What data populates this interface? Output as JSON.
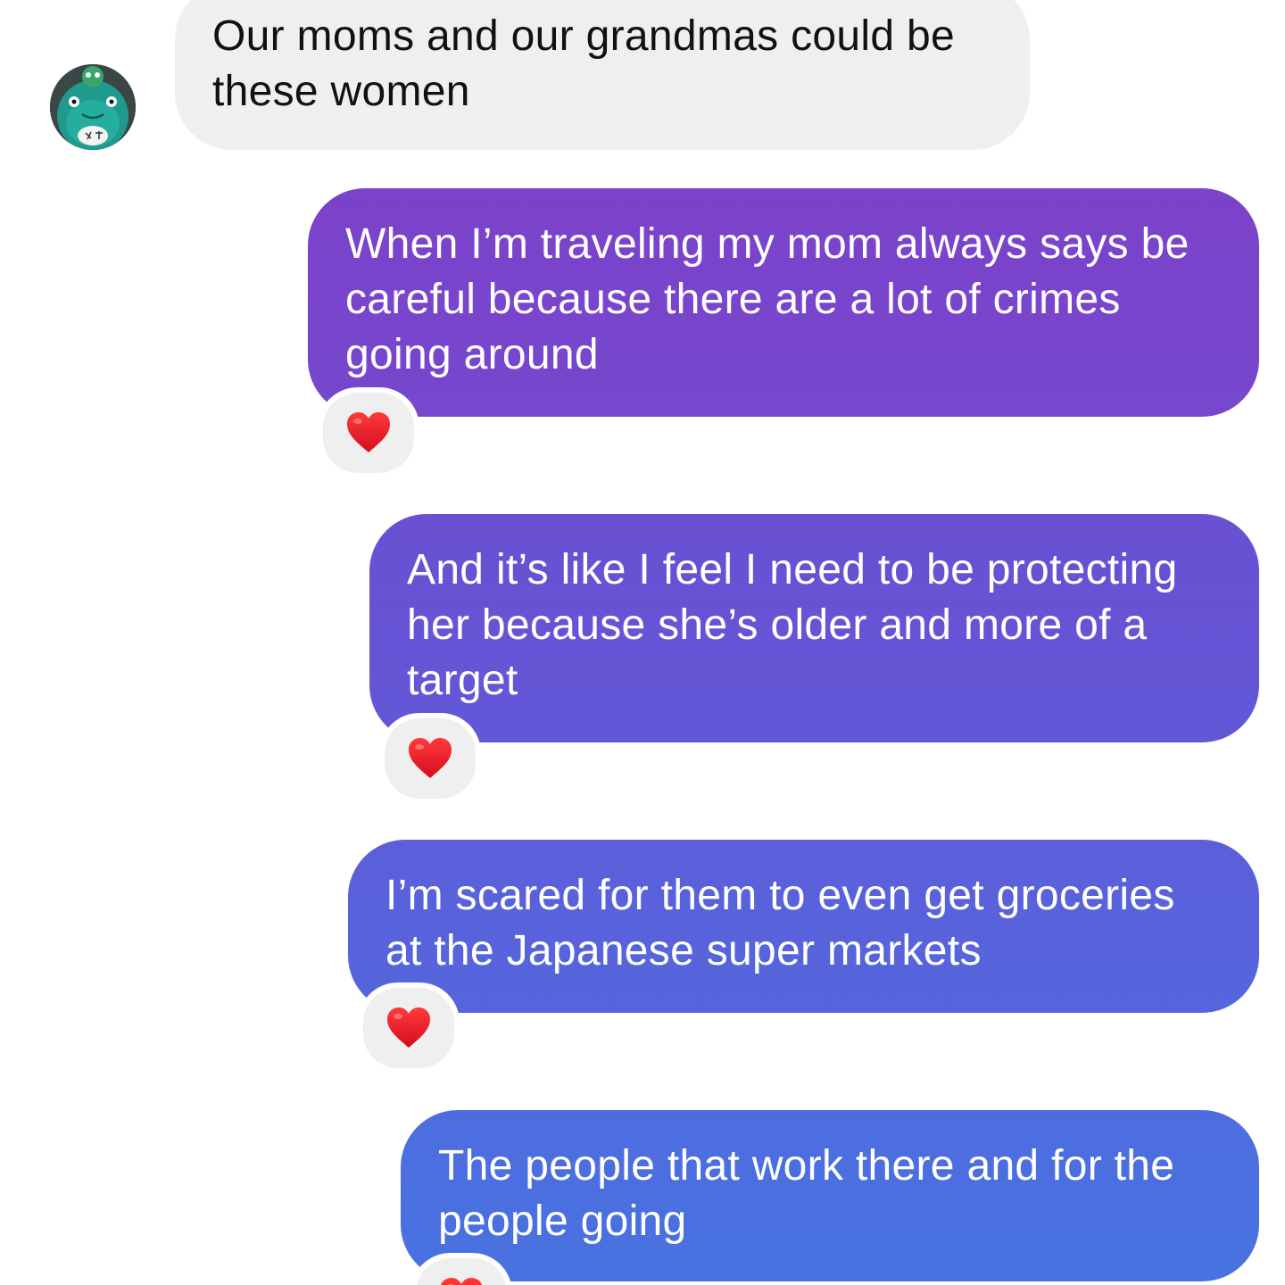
{
  "messages": [
    {
      "direction": "incoming",
      "text": "Our moms and our grandmas could be these women"
    },
    {
      "direction": "outgoing",
      "text": "When I’m traveling my mom always says be careful because there are a lot of crimes going around",
      "reaction": "heart"
    },
    {
      "direction": "outgoing",
      "text": "And it’s like I feel I need to be protecting her because she’s older and more of a target",
      "reaction": "heart"
    },
    {
      "direction": "outgoing",
      "text": "I’m scared for them to even get groceries at the Japanese super markets",
      "reaction": "heart"
    },
    {
      "direction": "outgoing",
      "text": "The people that work there and for the people going",
      "reaction": "heart"
    }
  ],
  "colors": {
    "incoming_bubble": "#efefef",
    "outgoing_top": "#7b42ca",
    "outgoing_bottom": "#4872e0",
    "heart": "#e8112d"
  },
  "icons": {
    "avatar": "frog-figurine-avatar",
    "reaction": "red-heart-icon"
  }
}
